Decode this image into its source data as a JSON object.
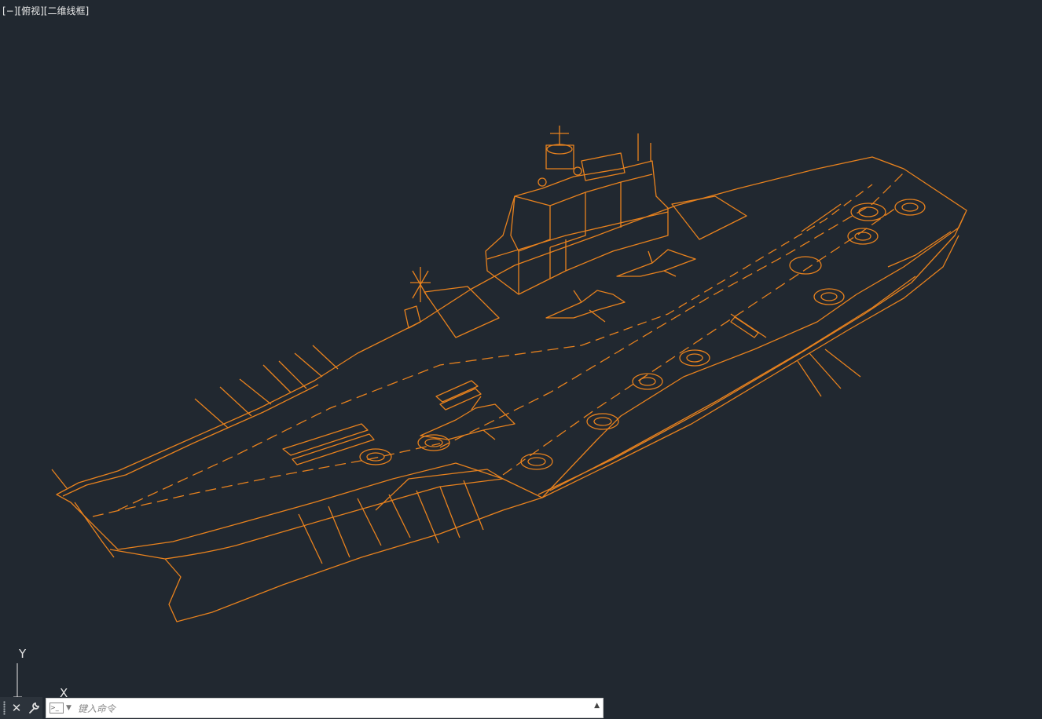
{
  "viewport": {
    "controls": "[−]",
    "view": "[俯视]",
    "style": "[二维线框]"
  },
  "ucs": {
    "y_label": "Y",
    "x_label": "X"
  },
  "drawing": {
    "stroke_color": "#e8821e"
  },
  "command_line": {
    "close_icon": "✕",
    "wrench_icon": "wrench-icon",
    "placeholder": "键入命令"
  }
}
